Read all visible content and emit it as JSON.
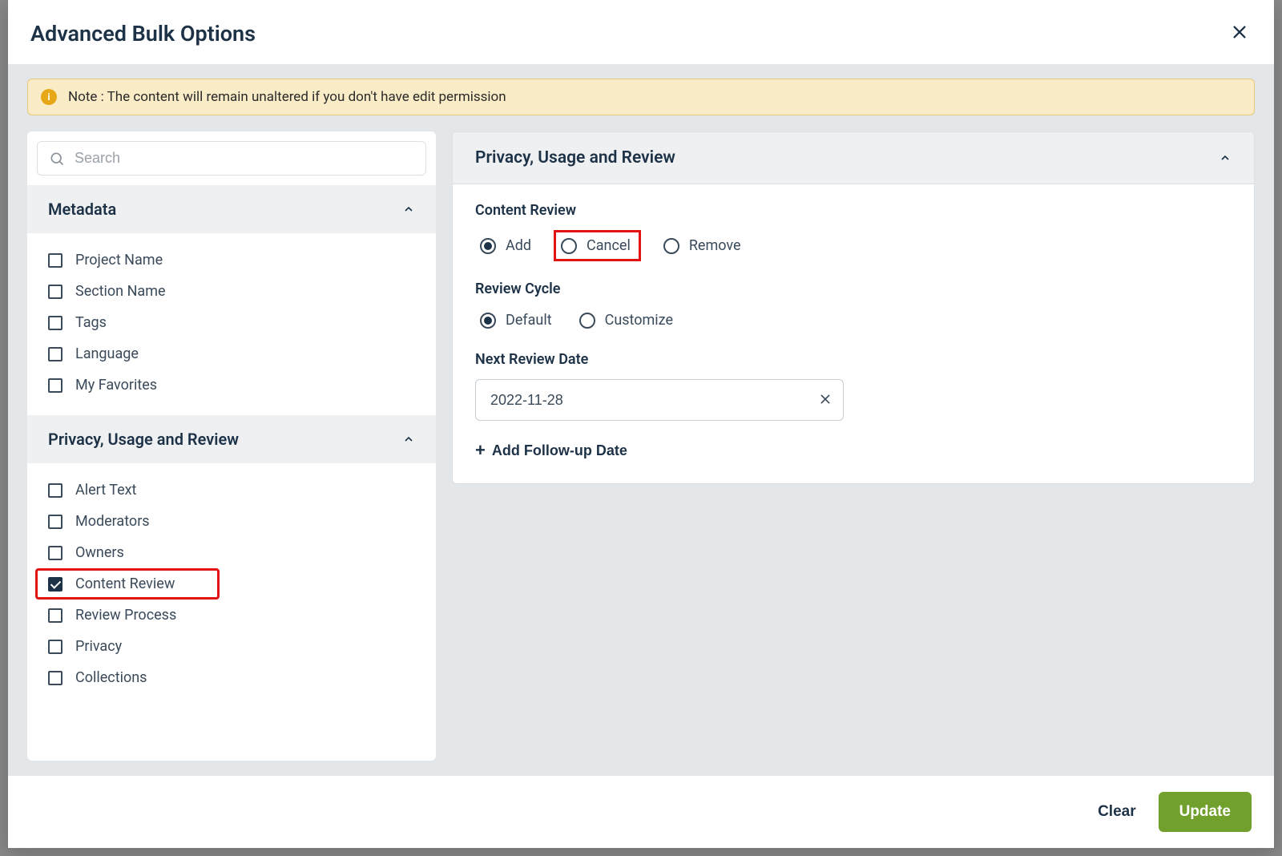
{
  "modal": {
    "title": "Advanced Bulk Options",
    "note": "Note : The content will remain unaltered if you don't have edit permission"
  },
  "search": {
    "placeholder": "Search"
  },
  "sections": {
    "metadata": {
      "title": "Metadata",
      "items": [
        "Project Name",
        "Section Name",
        "Tags",
        "Language",
        "My Favorites"
      ]
    },
    "privacy": {
      "title": "Privacy, Usage and Review",
      "items": [
        "Alert Text",
        "Moderators",
        "Owners",
        "Content Review",
        "Review Process",
        "Privacy",
        "Collections"
      ]
    }
  },
  "rightPanel": {
    "title": "Privacy, Usage and Review",
    "contentReview": {
      "label": "Content Review",
      "options": {
        "add": "Add",
        "cancel": "Cancel",
        "remove": "Remove"
      }
    },
    "reviewCycle": {
      "label": "Review Cycle",
      "options": {
        "default": "Default",
        "customize": "Customize"
      }
    },
    "nextReviewDate": {
      "label": "Next Review Date",
      "value": "2022-11-28"
    },
    "addFollowup": "Add Follow-up Date"
  },
  "footer": {
    "clear": "Clear",
    "update": "Update"
  }
}
